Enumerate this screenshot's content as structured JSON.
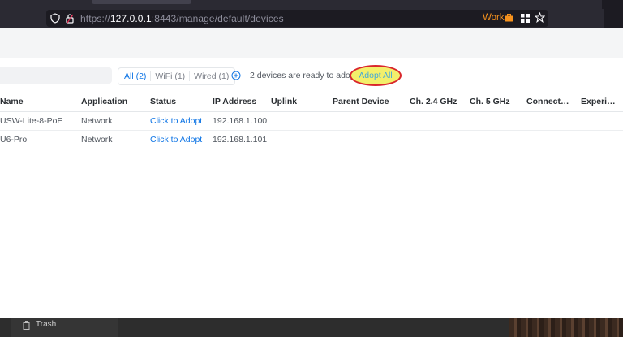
{
  "browser": {
    "url_prefix": "https://",
    "url_host": "127.0.0.1",
    "url_rest": ":8443/manage/default/devices",
    "container": "Work"
  },
  "filters": {
    "all": "All (2)",
    "wifi": "WiFi (1)",
    "wired": "Wired (1)"
  },
  "adopt": {
    "message": "2 devices are ready to adopt.",
    "button": "Adopt All"
  },
  "table": {
    "columns": [
      "Name",
      "Application",
      "Status",
      "IP Address",
      "Uplink",
      "Parent Device",
      "Ch. 2.4 GHz",
      "Ch. 5 GHz",
      "Connect…",
      "Experi…"
    ],
    "rows": [
      {
        "name": "USW-Lite-8-PoE",
        "application": "Network",
        "status": "Click to Adopt",
        "ip": "192.168.1.100"
      },
      {
        "name": "U6-Pro",
        "application": "Network",
        "status": "Click to Adopt",
        "ip": "192.168.1.101"
      }
    ]
  },
  "desktop": {
    "trash_label": "Trash"
  },
  "colors": {
    "accent": "#0d74e5",
    "highlight_fill": "#f3ef6b",
    "highlight_ring": "#d9262b",
    "container": "#f7931e"
  }
}
